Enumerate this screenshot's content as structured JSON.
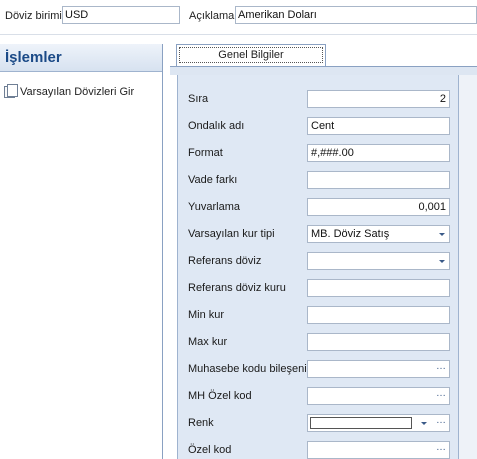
{
  "header": {
    "currency_label": "Döviz birimi",
    "currency_value": "USD",
    "description_label": "Açıklama",
    "description_value": "Amerikan Doları"
  },
  "left_panel": {
    "title": "İşlemler",
    "items": [
      {
        "label": "Varsayılan Dövizleri Gir",
        "icon": "document-icon"
      }
    ]
  },
  "tabs": [
    {
      "label": "Genel Bilgiler",
      "active": true
    }
  ],
  "form": {
    "fields": [
      {
        "label": "Sıra",
        "value": "2",
        "type": "text",
        "align": "right"
      },
      {
        "label": "Ondalık adı",
        "value": "Cent",
        "type": "text",
        "align": "left"
      },
      {
        "label": "Format",
        "value": "#,###.00",
        "type": "text",
        "align": "left"
      },
      {
        "label": "Vade farkı",
        "value": "",
        "type": "text",
        "align": "left"
      },
      {
        "label": "Yuvarlama",
        "value": "0,001",
        "type": "text",
        "align": "right"
      },
      {
        "label": "Varsayılan kur tipi",
        "value": "MB. Döviz Satış",
        "type": "dropdown",
        "align": "left"
      },
      {
        "label": "Referans döviz",
        "value": "",
        "type": "dropdown",
        "align": "left"
      },
      {
        "label": "Referans döviz kuru",
        "value": "",
        "type": "text",
        "align": "left"
      },
      {
        "label": "Min kur",
        "value": "",
        "type": "text",
        "align": "left"
      },
      {
        "label": "Max kur",
        "value": "",
        "type": "text",
        "align": "left"
      },
      {
        "label": "Muhasebe kodu bileşeni",
        "value": "",
        "type": "lookup",
        "align": "left"
      },
      {
        "label": "MH Özel kod",
        "value": "",
        "type": "lookup",
        "align": "left"
      },
      {
        "label": "Renk",
        "value": "",
        "type": "color",
        "align": "left"
      },
      {
        "label": "Özel kod",
        "value": "",
        "type": "lookup",
        "align": "left"
      }
    ]
  },
  "icons": {
    "dropdown": "chevron-down-icon",
    "lookup": "ellipsis-icon"
  },
  "colors": {
    "accent": "#1b4a87",
    "panel_bg": "#dfe8f4",
    "border": "#8aa1c2"
  }
}
